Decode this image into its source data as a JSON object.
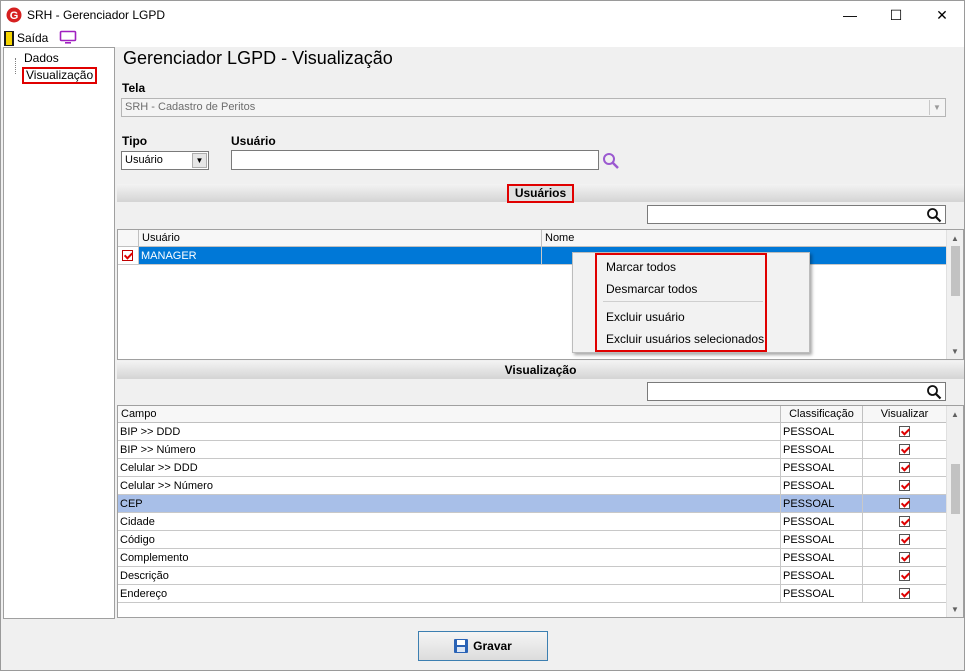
{
  "window": {
    "title": "SRH - Gerenciador LGPD",
    "minimize": "—",
    "maximize": "☐",
    "close": "✕"
  },
  "menu": {
    "exit_label": "Saída"
  },
  "tree": {
    "items": [
      "Dados",
      "Visualização"
    ],
    "selected": "Visualização"
  },
  "page": {
    "title": "Gerenciador LGPD - Visualização"
  },
  "tela": {
    "label": "Tela",
    "value": "SRH - Cadastro de Peritos"
  },
  "filters": {
    "tipo_label": "Tipo",
    "tipo_value": "Usuário",
    "usuario_label": "Usuário",
    "usuario_value": ""
  },
  "users_section": {
    "title": "Usuários",
    "search_value": "",
    "columns": [
      "Usuário",
      "Nome"
    ],
    "rows": [
      {
        "checked": true,
        "usuario": "MANAGER",
        "nome": ""
      }
    ]
  },
  "context_menu": {
    "items": [
      "Marcar todos",
      "Desmarcar todos",
      "Excluir usuário",
      "Excluir usuários selecionados"
    ]
  },
  "viz_section": {
    "title": "Visualização",
    "search_value": "",
    "columns": [
      "Campo",
      "Classificação",
      "Visualizar"
    ],
    "rows": [
      {
        "campo": "BIP >> DDD",
        "classificacao": "PESSOAL",
        "visualizar": true
      },
      {
        "campo": "BIP >> Número",
        "classificacao": "PESSOAL",
        "visualizar": true
      },
      {
        "campo": "Celular >> DDD",
        "classificacao": "PESSOAL",
        "visualizar": true
      },
      {
        "campo": "Celular >> Número",
        "classificacao": "PESSOAL",
        "visualizar": true
      },
      {
        "campo": "CEP",
        "classificacao": "PESSOAL",
        "visualizar": true
      },
      {
        "campo": "Cidade",
        "classificacao": "PESSOAL",
        "visualizar": true
      },
      {
        "campo": "Código",
        "classificacao": "PESSOAL",
        "visualizar": true
      },
      {
        "campo": "Complemento",
        "classificacao": "PESSOAL",
        "visualizar": true
      },
      {
        "campo": "Descrição",
        "classificacao": "PESSOAL",
        "visualizar": true
      },
      {
        "campo": "Endereço",
        "classificacao": "PESSOAL",
        "visualizar": true
      }
    ],
    "highlighted_row": "CEP"
  },
  "footer": {
    "save_label": "Gravar"
  },
  "colors": {
    "selection": "#0078d7",
    "highlight_row": "#a8bfe8",
    "annotation_red": "#e00000"
  }
}
